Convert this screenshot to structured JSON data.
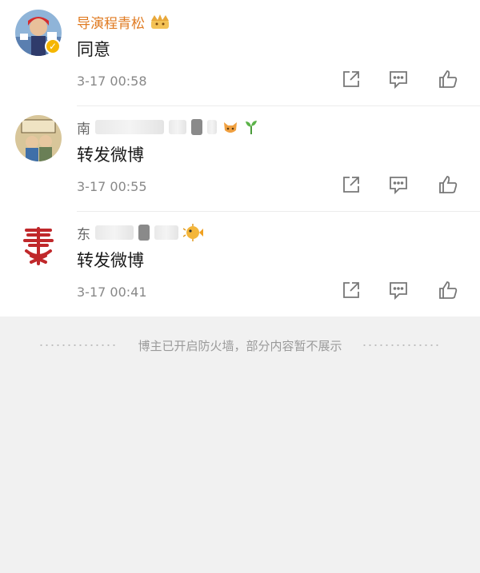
{
  "comments": [
    {
      "name": "导演程青松",
      "content": "同意",
      "time": "3-17 00:58",
      "verified_badge": "✓"
    },
    {
      "name": "南",
      "content": "转发微博",
      "time": "3-17 00:55"
    },
    {
      "name": "东",
      "content": "转发微博",
      "time": "3-17 00:41"
    }
  ],
  "footer": {
    "notice": "博主已开启防火墙，部分内容暂不展示"
  },
  "icons": {
    "repost": "repost-icon",
    "reply": "reply-icon",
    "like": "like-icon",
    "verified": "verified-badge-icon",
    "crown": "crown-icon",
    "sprout": "sprout-icon",
    "pufferfish": "pufferfish-icon"
  },
  "colors": {
    "name_accent": "#e07b22",
    "background": "#f1f1f1",
    "badge": "#f5b600"
  }
}
